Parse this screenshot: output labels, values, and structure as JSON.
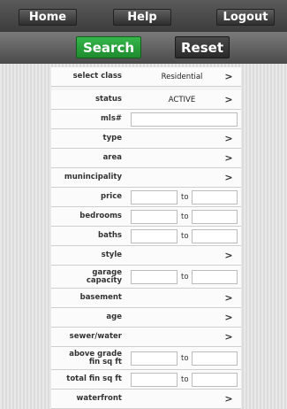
{
  "nav": {
    "home": "Home",
    "help": "Help",
    "logout": "Logout"
  },
  "actions": {
    "search": "Search",
    "reset": "Reset"
  },
  "form": {
    "select_class": {
      "label": "select class",
      "value": "Residential"
    },
    "status": {
      "label": "status",
      "value": "ACTIVE"
    },
    "mls": {
      "label": "mls#",
      "value": ""
    },
    "type": {
      "label": "type"
    },
    "area": {
      "label": "area"
    },
    "municipality": {
      "label": "munincipality"
    },
    "price": {
      "label": "price",
      "from": "",
      "to_label": "to",
      "to": ""
    },
    "bedrooms": {
      "label": "bedrooms",
      "from": "",
      "to_label": "to",
      "to": ""
    },
    "baths": {
      "label": "baths",
      "from": "",
      "to_label": "to",
      "to": ""
    },
    "style": {
      "label": "style"
    },
    "garage": {
      "label_line1": "garage",
      "label_line2": "capacity",
      "from": "",
      "to_label": "to",
      "to": ""
    },
    "basement": {
      "label": "basement"
    },
    "age": {
      "label": "age"
    },
    "sewer_water": {
      "label": "sewer/water"
    },
    "above_grade": {
      "label_line1": "above grade",
      "label_line2": "fin sq ft",
      "from": "",
      "to_label": "to",
      "to": ""
    },
    "total_fin": {
      "label": "total fin sq ft",
      "from": "",
      "to_label": "to",
      "to": ""
    },
    "waterfront": {
      "label": "waterfront"
    }
  },
  "chevron_glyph": ">"
}
